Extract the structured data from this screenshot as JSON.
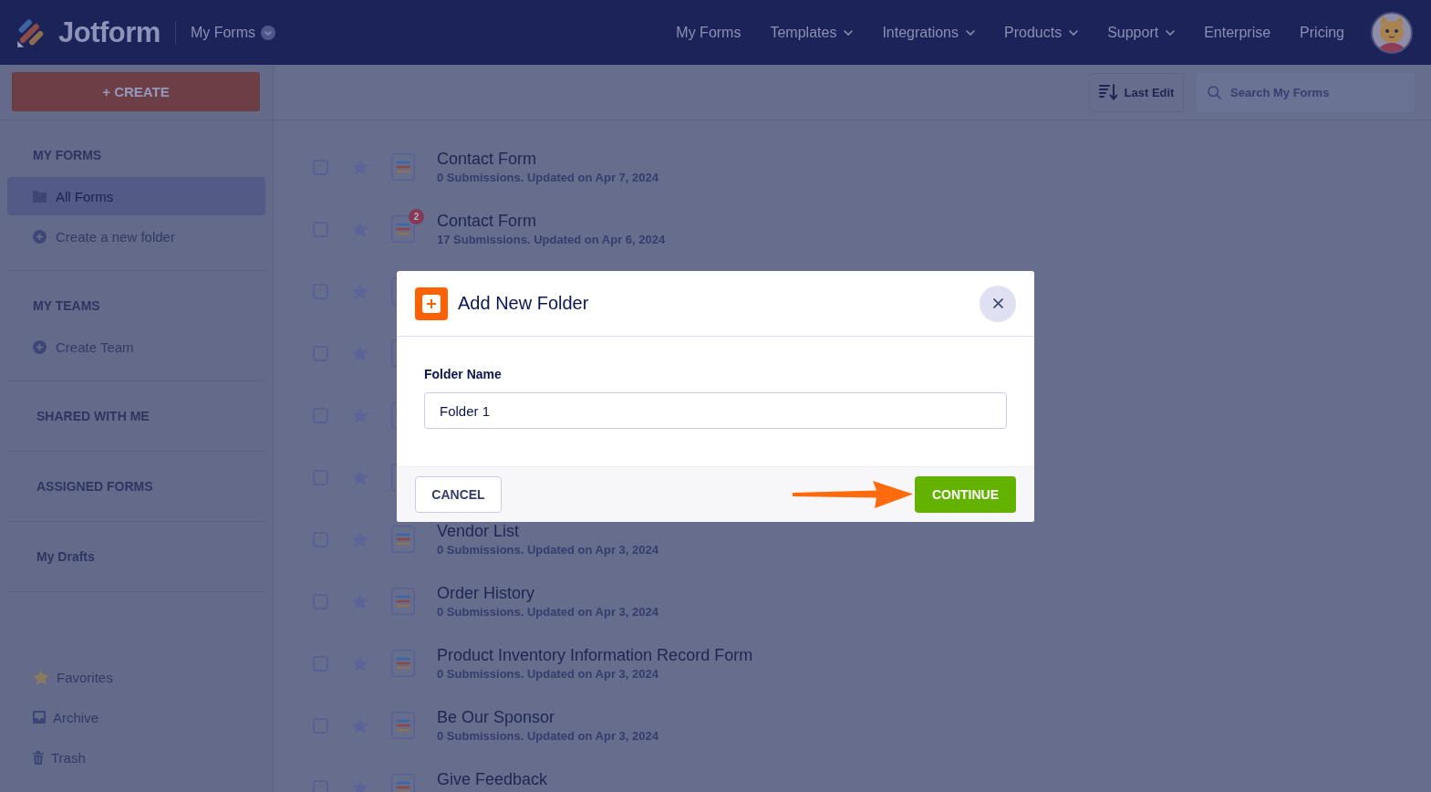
{
  "header": {
    "logo_text": "Jotform",
    "workspace_menu": "My Forms",
    "nav": [
      {
        "label": "My Forms",
        "has_dropdown": false
      },
      {
        "label": "Templates",
        "has_dropdown": true
      },
      {
        "label": "Integrations",
        "has_dropdown": true
      },
      {
        "label": "Products",
        "has_dropdown": true
      },
      {
        "label": "Support",
        "has_dropdown": true
      },
      {
        "label": "Enterprise",
        "has_dropdown": false
      },
      {
        "label": "Pricing",
        "has_dropdown": false
      }
    ]
  },
  "sidebar": {
    "create_button": "+ CREATE",
    "sections": [
      {
        "kind": "group",
        "title": "MY FORMS",
        "items": [
          {
            "kind": "folder",
            "label": "All Forms",
            "selected": true
          },
          {
            "kind": "add",
            "label": "Create a new folder",
            "selected": false
          }
        ]
      },
      {
        "kind": "group",
        "title": "MY TEAMS",
        "items": [
          {
            "kind": "add",
            "label": "Create Team",
            "selected": false
          }
        ]
      },
      {
        "kind": "link",
        "title": "SHARED WITH ME"
      },
      {
        "kind": "link",
        "title": "ASSIGNED FORMS"
      },
      {
        "kind": "link",
        "title": "My Drafts"
      }
    ],
    "bottom_items": [
      {
        "kind": "favorites",
        "label": "Favorites",
        "selected": false
      },
      {
        "kind": "archive",
        "label": "Archive",
        "selected": false
      },
      {
        "kind": "trash",
        "label": "Trash",
        "selected": false
      }
    ]
  },
  "toolbar": {
    "sort_button": "Last Edit",
    "search": {
      "placeholder": "Search My Forms"
    }
  },
  "forms": [
    {
      "title": "Contact Form",
      "subtitle": "0 Submissions. Updated on Apr 7, 2024",
      "checked": false,
      "starred": false
    },
    {
      "title": "Contact Form",
      "subtitle": "17 Submissions. Updated on Apr 6, 2024",
      "badge": "2",
      "checked": false,
      "starred": false
    },
    {
      "checked": false,
      "starred": false
    },
    {
      "checked": false,
      "starred": false
    },
    {
      "checked": false,
      "starred": false
    },
    {
      "checked": false,
      "starred": false
    },
    {
      "title": "Vendor List",
      "subtitle": "0 Submissions. Updated on Apr 3, 2024",
      "checked": false,
      "starred": false
    },
    {
      "title": "Order History",
      "subtitle": "0 Submissions. Updated on Apr 3, 2024",
      "checked": false,
      "starred": false
    },
    {
      "title": "Product Inventory Information Record Form",
      "subtitle": "0 Submissions. Updated on Apr 3, 2024",
      "checked": false,
      "starred": false
    },
    {
      "title": "Be Our Sponsor",
      "subtitle": "0 Submissions. Updated on Apr 3, 2024",
      "checked": false,
      "starred": false
    },
    {
      "title": "Give Feedback",
      "checked": false,
      "starred": false
    }
  ],
  "modal": {
    "title": "Add New Folder",
    "field_label": "Folder Name",
    "field_value": "Folder 1",
    "buttons": [
      {
        "kind": "secondary",
        "label": "CANCEL"
      },
      {
        "kind": "primary",
        "label": "CONTINUE"
      }
    ]
  }
}
